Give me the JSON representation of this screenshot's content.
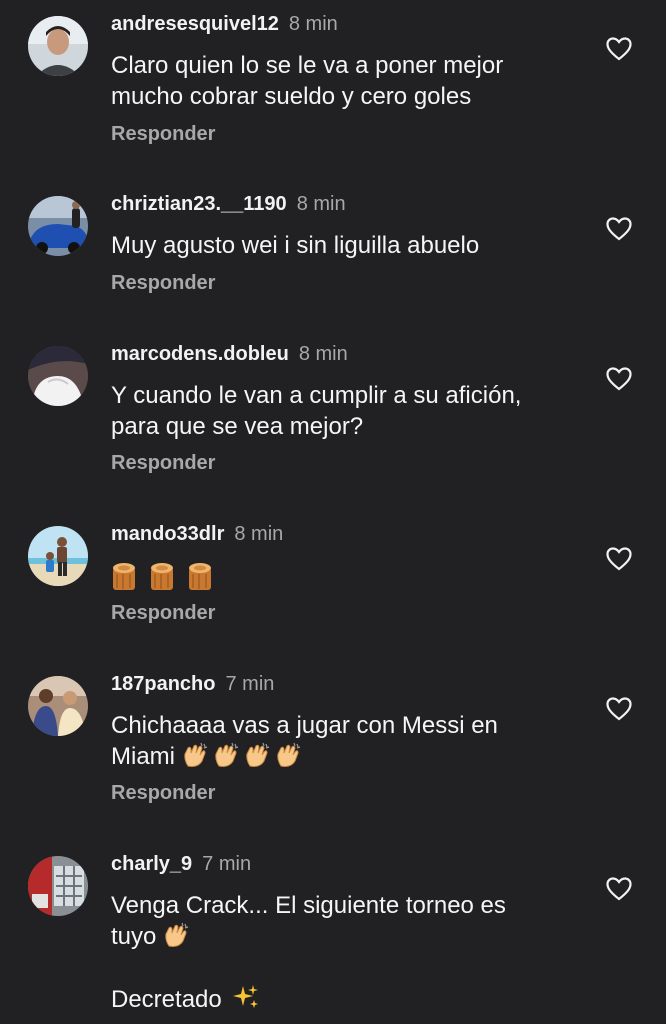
{
  "reply_label": "Responder",
  "colors": {
    "background": "#212124",
    "text": "#f5f5f5",
    "secondary": "#a8a8a8"
  },
  "comments": [
    {
      "username": "andresesquivel12",
      "time": "8 min",
      "lines": [
        "Claro quien lo se le va a poner mejor",
        "mucho cobrar sueldo y cero goles"
      ]
    },
    {
      "username": "chriztian23.__1190",
      "time": "8 min",
      "lines": [
        "Muy agusto wei i sin liguilla abuelo"
      ]
    },
    {
      "username": "marcodens.dobleu",
      "time": "8 min",
      "lines": [
        "Y cuando le van a cumplir a su afición,",
        "para que se vea mejor?"
      ]
    },
    {
      "username": "mando33dlr",
      "time": "8 min",
      "emojis": [
        "wood-emoji",
        "wood-emoji",
        "wood-emoji"
      ]
    },
    {
      "username": "187pancho",
      "time": "7 min",
      "lines": [
        "Chichaaaa vas a jugar con Messi en",
        "Miami"
      ],
      "emojis": [
        "clapping-hands-emoji",
        "clapping-hands-emoji",
        "clapping-hands-emoji",
        "clapping-hands-emoji"
      ]
    },
    {
      "username": "charly_9",
      "time": "7 min",
      "lines": [
        "Venga Crack... El siguiente torneo es",
        "tuyo",
        "Decretado"
      ],
      "emojis": [
        "clapping-hands-emoji",
        "sparkles-emoji"
      ]
    }
  ]
}
